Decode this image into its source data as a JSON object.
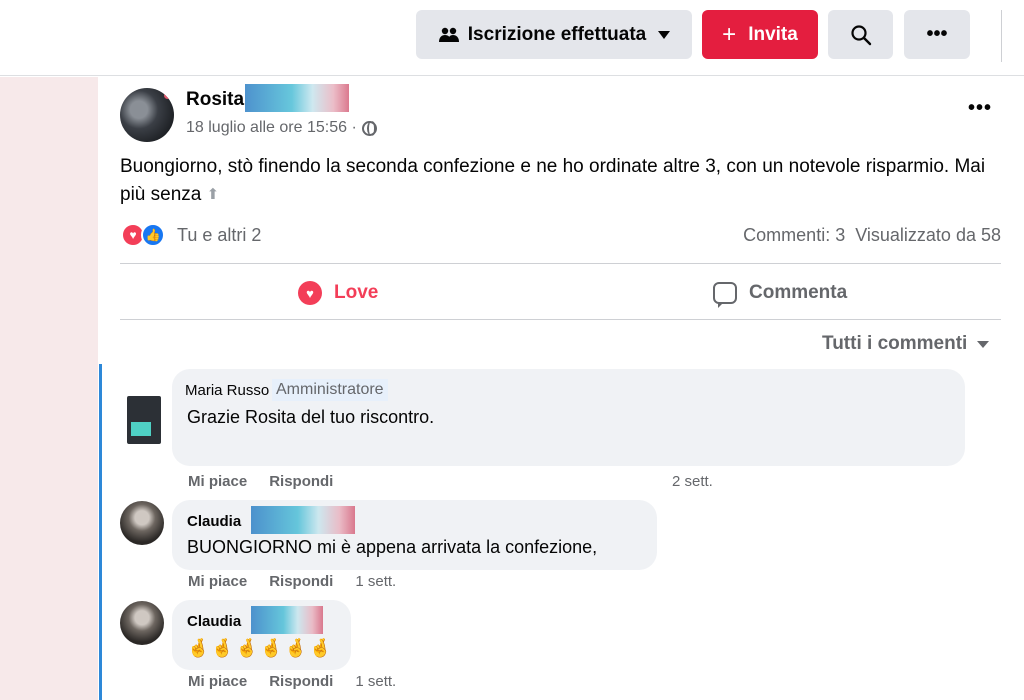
{
  "toolbar": {
    "joined_label": "Iscrizione effettuata",
    "invite_label": "Invita"
  },
  "post": {
    "author": "Rosita",
    "meta": "18 luglio alle ore 15:56 ·",
    "text": "Buongiorno,  stò finendo la seconda confezione e ne ho ordinate altre 3, con un notevole risparmio.  Mai più senza",
    "reactions_text": "Tu e altri 2",
    "comments_count": "Commenti: 3",
    "views": "Visualizzato da 58",
    "love_label": "Love",
    "comment_label": "Commenta",
    "sort_label": "Tutti i commenti"
  },
  "comments": [
    {
      "author": "Maria Russo",
      "badge": "Amministratore",
      "text": "Grazie Rosita del tuo riscontro.",
      "like": "Mi piace",
      "reply": "Rispondi",
      "time": "2 sett."
    },
    {
      "author": "Claudia",
      "text": "BUONGIORNO mi è appena arrivata la confezione,",
      "like": "Mi piace",
      "reply": "Rispondi",
      "time": "1 sett."
    },
    {
      "author": "Claudia",
      "text": "🤞🤞🤞🤞🤞🤞",
      "like": "Mi piace",
      "reply": "Rispondi",
      "time": "1 sett."
    }
  ],
  "icons": {
    "joined": "people-icon",
    "invite": "plus-icon",
    "search": "search-icon",
    "more": "more-icon",
    "love": "heart-icon",
    "comment": "comment-icon",
    "privacy": "globe-icon"
  },
  "colors": {
    "accent_red": "#e41e3f",
    "love": "#f33e58",
    "like": "#1877f2",
    "admin_badge_bg": "#e7f0fb",
    "comment_thread_line": "#2d88d8"
  }
}
